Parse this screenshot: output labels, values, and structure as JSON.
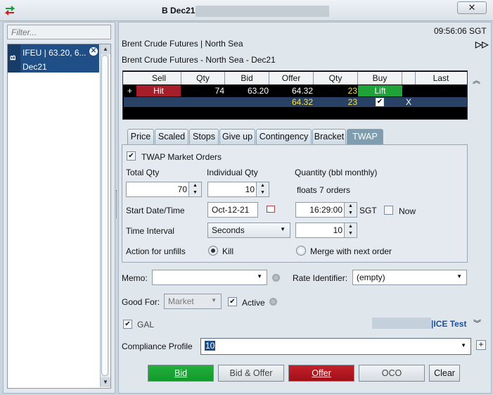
{
  "window": {
    "title": "B Dec21",
    "close_glyph": "✕"
  },
  "left": {
    "filter_placeholder": "Filter...",
    "item": {
      "badge": "B",
      "line1": "IFEU | 63.20, 6...",
      "line2": "Dec21"
    }
  },
  "header": {
    "clock": "09:56:06 SGT",
    "instrument_line1": "Brent Crude Futures | North Sea",
    "instrument_line2": "Brent Crude Futures - North Sea - Dec21"
  },
  "market": {
    "columns": [
      "Sell",
      "Qty",
      "Bid",
      "Offer",
      "Qty",
      "Buy",
      "",
      "Last"
    ],
    "row1": {
      "marker": "+",
      "sell": "Hit",
      "bid_qty": "74",
      "bid": "63.20",
      "offer": "64.32",
      "offer_qty": "23",
      "buy": "Lift"
    },
    "row2": {
      "offer": "64.32",
      "offer_qty": "23",
      "x": "X"
    }
  },
  "tabs": [
    "Price",
    "Scaled",
    "Stops",
    "Give up",
    "Contingency",
    "Bracket",
    "TWAP"
  ],
  "twap": {
    "market_orders_label": "TWAP Market Orders",
    "total_qty_label": "Total Qty",
    "total_qty": "70",
    "individual_qty_label": "Individual Qty",
    "individual_qty": "10",
    "quantity_label": "Quantity (bbl monthly)",
    "floats_text": "floats 7 orders",
    "start_label": "Start Date/Time",
    "start_date": "Oct-12-21",
    "start_time": "16:29:00",
    "tz": "SGT",
    "now_label": "Now",
    "interval_label": "Time Interval",
    "interval_unit": "Seconds",
    "interval_value": "10",
    "unfills_label": "Action for unfills",
    "kill_label": "Kill",
    "merge_label": "Merge with next order"
  },
  "memo": {
    "label": "Memo:",
    "value": ""
  },
  "rate": {
    "label": "Rate Identifier:",
    "value": "(empty)"
  },
  "good_for": {
    "label": "Good For:",
    "value": "Market",
    "active_label": "Active"
  },
  "gal": {
    "label": "GAL",
    "ice_link": "|ICE Test"
  },
  "compliance": {
    "label": "Compliance Profile",
    "value": "10"
  },
  "buttons": {
    "bid": "Bid",
    "bid_offer": "Bid & Offer",
    "offer": "Offer",
    "oco": "OCO",
    "clear": "Clear"
  }
}
